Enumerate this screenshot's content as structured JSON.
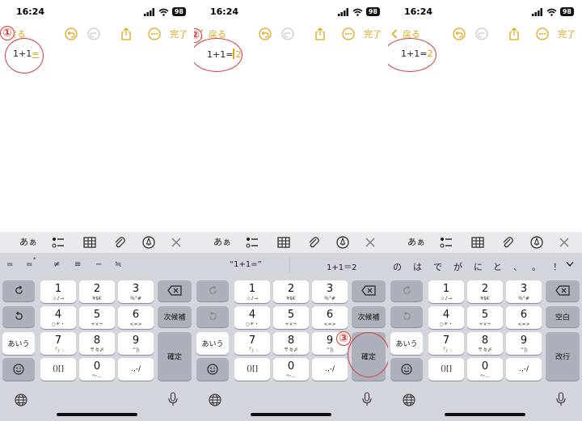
{
  "status": {
    "time": "16:24",
    "battery": "98"
  },
  "toolbar": {
    "back_label": "戻る",
    "done_label": "完了"
  },
  "panels": [
    {
      "marker": "①",
      "note_prefix": "1+1",
      "note_suffix": "="
    },
    {
      "marker": "②",
      "note_prefix": "1+1=",
      "note_suffix": "2"
    },
    {
      "marker": "④",
      "note_prefix": "1+1=",
      "note_suffix": "2"
    }
  ],
  "extra_marker": "③",
  "keyboard": {
    "accessory": {
      "aa_label": "あぁ"
    },
    "candidates_1": [
      "=",
      "=",
      "≠",
      "≡",
      "−",
      "≒"
    ],
    "candidate_1_star": "*",
    "candidates_2": [
      "“1+1=”",
      "1+1＝2"
    ],
    "candidates_3": [
      "の",
      "は",
      "で",
      "が",
      "に",
      "と",
      "、",
      "。",
      "！"
    ],
    "key_labels": {
      "k1": "1",
      "k1s": "☆♪→",
      "k2": "2",
      "k2s": "¥$€",
      "k3": "3",
      "k3s": "%°#",
      "k4": "4",
      "k4s": "○＊・",
      "k5": "5",
      "k5s": "+×÷",
      "k6": "6",
      "k6s": "<=>",
      "k7": "7",
      "k7s": "「」:",
      "k8": "8",
      "k8s": "〒々〆",
      "k9": "9",
      "k9s": "^|\\",
      "k0": "0",
      "k0s": "〜…",
      "brackets": "()[]",
      "punct": ".,-/",
      "aiu": "あいう",
      "next_candidate": "次候補",
      "confirm": "確定",
      "space": "空白",
      "newline": "改行"
    }
  }
}
